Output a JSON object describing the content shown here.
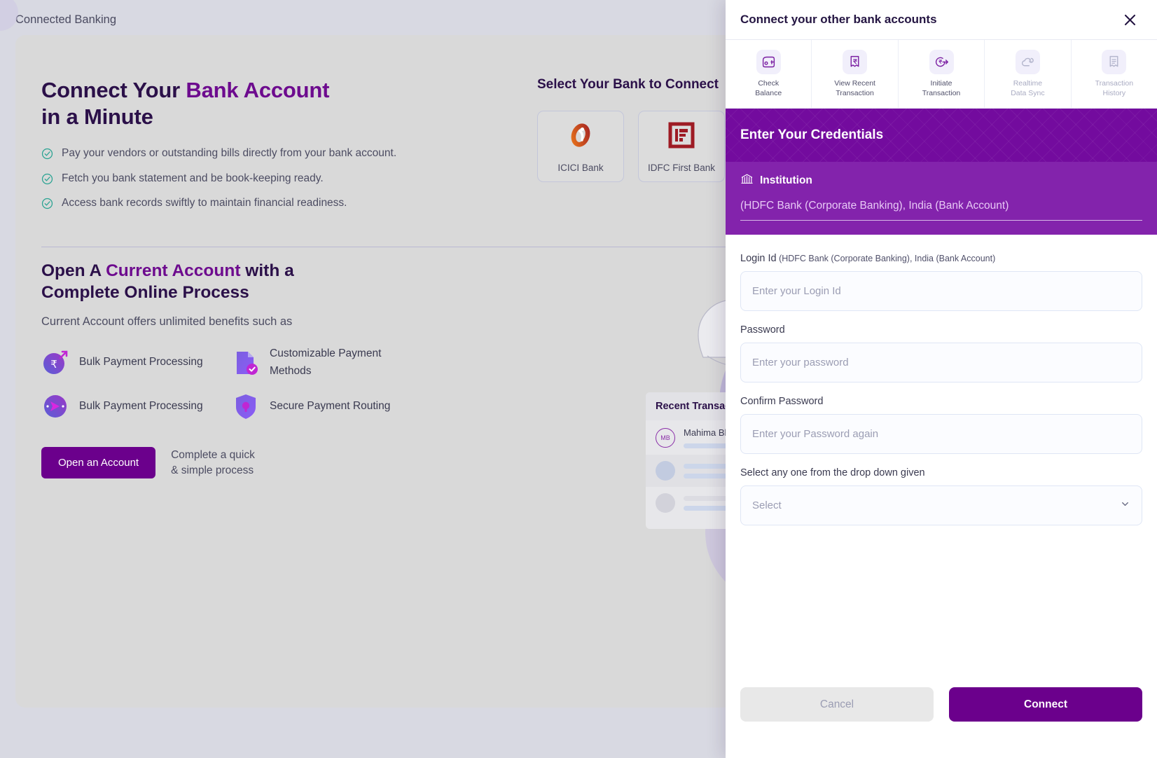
{
  "page": {
    "header_title": "Connected Banking"
  },
  "hero": {
    "title_part1": "Connect Your ",
    "title_accent": "Bank Account",
    "title_part2": "in a Minute",
    "bullets": [
      "Pay your vendors or outstanding bills directly from your bank account.",
      "Fetch you bank statement and be book-keeping ready.",
      "Access bank records swiftly to maintain financial readiness."
    ]
  },
  "bank_select": {
    "title": "Select Your Bank to Connect",
    "banks": [
      {
        "name": "ICICI Bank",
        "logo": "icici-logo"
      },
      {
        "name": "IDFC First Bank",
        "logo": "idfc-logo"
      }
    ]
  },
  "current_account": {
    "title_part1": "Open A ",
    "title_accent": "Current Account",
    "title_part2": " with a",
    "title_line2": "Complete Online Process",
    "subtitle": "Current Account offers unlimited benefits such as",
    "features": [
      {
        "label": "Bulk Payment Processing",
        "icon": "rupee-growth-icon"
      },
      {
        "label": "Customizable Payment Methods",
        "icon": "document-check-icon"
      },
      {
        "label": "Bulk Payment Processing",
        "icon": "send-payment-icon"
      },
      {
        "label": "Secure Payment Routing",
        "icon": "shield-lock-icon"
      }
    ],
    "cta_label": "Open an Account",
    "cta_note_line1": "Complete a quick",
    "cta_note_line2": "& simple process"
  },
  "illustration": {
    "card_title": "Recent Transaction",
    "rows": [
      {
        "initials": "MB",
        "name": "Mahima Bhadala"
      },
      {
        "initials": "",
        "name": ""
      },
      {
        "initials": "",
        "name": ""
      }
    ]
  },
  "panel": {
    "title": "Connect your other bank accounts",
    "close_icon": "close-icon",
    "tabs": [
      {
        "label_line1": "Check",
        "label_line2": "Balance",
        "icon": "wallet-icon",
        "dim": false
      },
      {
        "label_line1": "View Recent",
        "label_line2": "Transaction",
        "icon": "receipt-rupee-icon",
        "dim": false
      },
      {
        "label_line1": "Initiate",
        "label_line2": "Transaction",
        "icon": "transfer-icon",
        "dim": false
      },
      {
        "label_line1": "Realtime",
        "label_line2": "Data Sync",
        "icon": "cloud-sync-icon",
        "dim": true
      },
      {
        "label_line1": "Transaction",
        "label_line2": "History",
        "icon": "history-list-icon",
        "dim": true
      }
    ],
    "credentials_heading": "Enter Your Credentials",
    "institution_label": "Institution",
    "institution_icon": "bank-icon",
    "institution_value": "(HDFC Bank (Corporate Banking), India (Bank Account)",
    "fields": {
      "login_id_label": "Login Id",
      "login_id_hint": " (HDFC Bank (Corporate Banking), India (Bank Account)",
      "login_id_placeholder": "Enter your Login Id",
      "login_id_value": "",
      "password_label": "Password",
      "password_placeholder": "Enter your password",
      "password_value": "",
      "confirm_password_label": "Confirm Password",
      "confirm_password_placeholder": "Enter your Password again",
      "confirm_password_value": "",
      "dropdown_label": "Select any one from the drop down given",
      "dropdown_value": "Select"
    },
    "cancel_label": "Cancel",
    "connect_label": "Connect"
  },
  "colors": {
    "brand_purple": "#6b008c",
    "accent_purple": "#730b9e",
    "institution_purple": "#8323ac",
    "heading_navy": "#2b1049",
    "page_bg": "#d8d9e2",
    "card_bg": "#d9d9d9",
    "check_green": "#2aa392"
  }
}
